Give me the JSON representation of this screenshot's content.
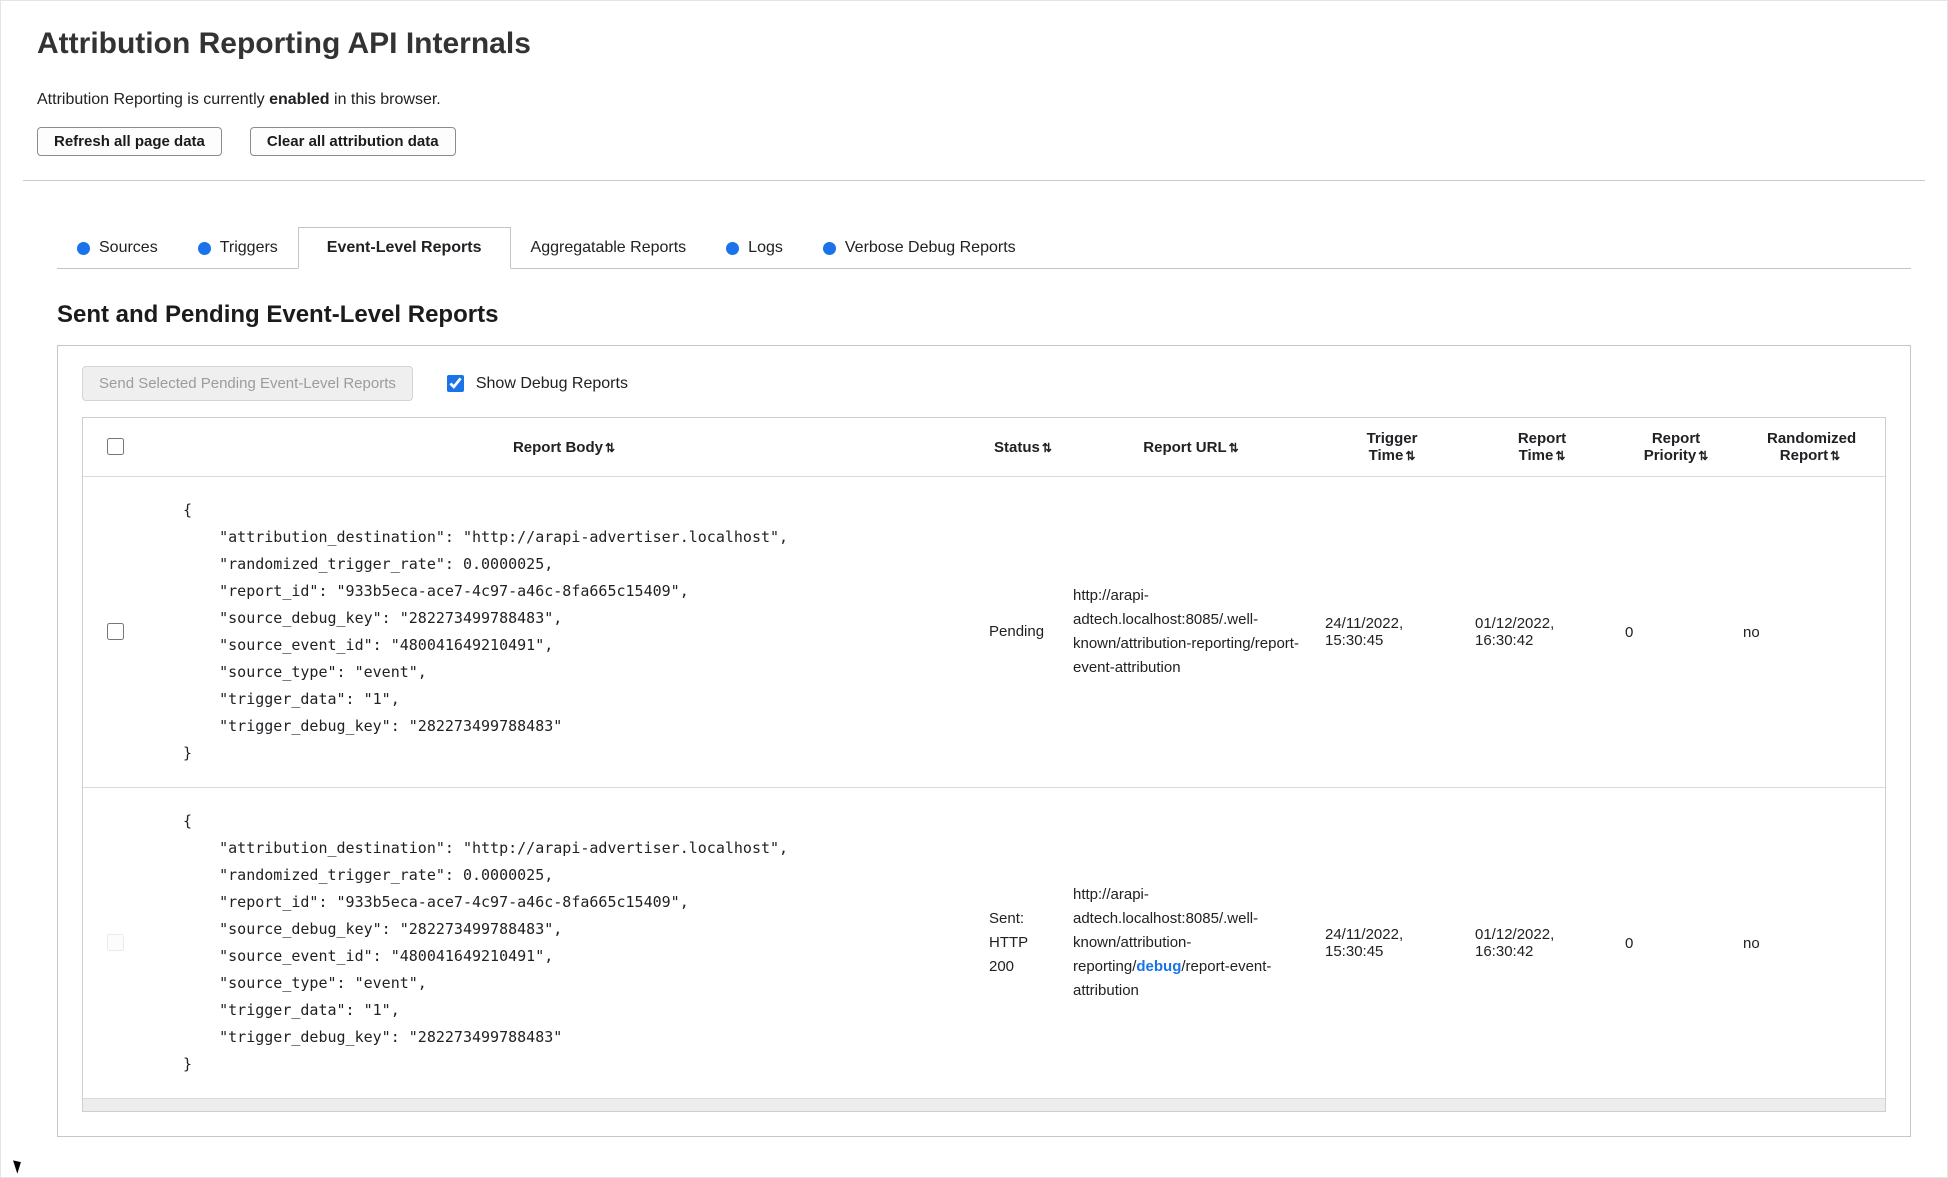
{
  "page": {
    "title": "Attribution Reporting API Internals",
    "status_prefix": "Attribution Reporting is currently ",
    "status_bold": "enabled",
    "status_suffix": " in this browser.",
    "refresh_button": "Refresh all page data",
    "clear_button": "Clear all attribution data"
  },
  "tabs": [
    {
      "label": "Sources",
      "has_dot": true,
      "active": false
    },
    {
      "label": "Triggers",
      "has_dot": true,
      "active": false
    },
    {
      "label": "Event-Level Reports",
      "has_dot": false,
      "active": true
    },
    {
      "label": "Aggregatable Reports",
      "has_dot": false,
      "active": false
    },
    {
      "label": "Logs",
      "has_dot": true,
      "active": false
    },
    {
      "label": "Verbose Debug Reports",
      "has_dot": true,
      "active": false
    }
  ],
  "colors": {
    "accent_blue": "#1a73e8"
  },
  "section_heading": "Sent and Pending Event-Level Reports",
  "panel": {
    "send_button": "Send Selected Pending Event-Level Reports",
    "send_button_disabled": true,
    "show_debug_label": "Show Debug Reports",
    "show_debug_checked": true
  },
  "table": {
    "sort_icon": "⇅",
    "headers": [
      "Report Body",
      "Status",
      "Report URL",
      "Trigger Time",
      "Report Time",
      "Report Priority",
      "Randomized Report"
    ],
    "rows": [
      {
        "body": "{\n    \"attribution_destination\": \"http://arapi-advertiser.localhost\",\n    \"randomized_trigger_rate\": 0.0000025,\n    \"report_id\": \"933b5eca-ace7-4c97-a46c-8fa665c15409\",\n    \"source_debug_key\": \"282273499788483\",\n    \"source_event_id\": \"480041649210491\",\n    \"source_type\": \"event\",\n    \"trigger_data\": \"1\",\n    \"trigger_debug_key\": \"282273499788483\"\n}",
        "status": "Pending",
        "url": "http://arapi-adtech.localhost:8085/.well-known/attribution-reporting/report-event-attribution",
        "trigger_time": "24/11/2022, 15:30:45",
        "report_time": "01/12/2022, 16:30:42",
        "priority": "0",
        "randomized": "no",
        "checkbox_disabled": false
      },
      {
        "body": "{\n    \"attribution_destination\": \"http://arapi-advertiser.localhost\",\n    \"randomized_trigger_rate\": 0.0000025,\n    \"report_id\": \"933b5eca-ace7-4c97-a46c-8fa665c15409\",\n    \"source_debug_key\": \"282273499788483\",\n    \"source_event_id\": \"480041649210491\",\n    \"source_type\": \"event\",\n    \"trigger_data\": \"1\",\n    \"trigger_debug_key\": \"282273499788483\"\n}",
        "status": "Sent: HTTP 200",
        "url_prefix": "http://arapi-adtech.localhost:8085/.well-known/attribution-reporting/",
        "url_link": "debug",
        "url_suffix": "/report-event-attribution",
        "trigger_time": "24/11/2022, 15:30:45",
        "report_time": "01/12/2022, 16:30:42",
        "priority": "0",
        "randomized": "no",
        "checkbox_disabled": true
      }
    ]
  }
}
